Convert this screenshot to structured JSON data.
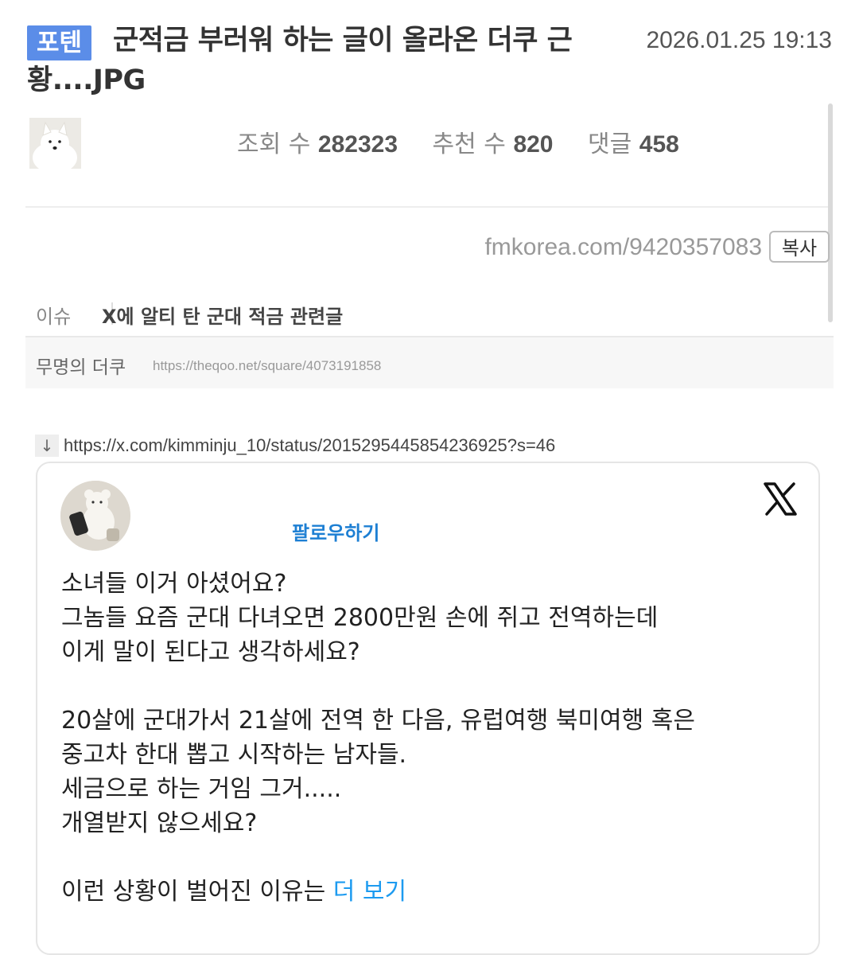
{
  "post": {
    "category": "포텐",
    "title": "군적금 부러워 하는 글이 올라온 더쿠 근황....JPG",
    "date": "2026.01.25 19:13"
  },
  "stats": {
    "views_label": "조회 수",
    "views": "282323",
    "recommend_label": "추천 수",
    "recommend": "820",
    "comments_label": "댓글",
    "comments": "458"
  },
  "share": {
    "short_url": "fmkorea.com/9420357083",
    "copy_label": "복사"
  },
  "issue": {
    "tag": "이슈",
    "title": "X에 알티 탄 군대 적금 관련글",
    "author": "무명의 더쿠",
    "source_url": "https://theqoo.net/square/4073191858"
  },
  "embed": {
    "icon": "download-arrow-icon",
    "url": "https://x.com/kimminju_10/status/2015295445854236925?s=46"
  },
  "tweet": {
    "follow_label": "팔로우하기",
    "lines": [
      "소녀들 이거 아셨어요?",
      "그놈들 요즘 군대 다녀오면 2800만원 손에 쥐고 전역하는데",
      "이게 말이 된다고 생각하세요?",
      "",
      "20살에 군대가서 21살에 전역 한 다음, 유럽여행 북미여행 혹은",
      "중고차 한대 뽑고 시작하는 남자들.",
      "세금으로 하는 거임 그거.....",
      "개열받지 않으세요?",
      ""
    ],
    "last_line": "이런 상황이 벌어진 이유는",
    "more_label": "더 보기"
  },
  "colors": {
    "badge": "#5b8de8",
    "follow": "#1d7fd3",
    "more": "#1d9bf0"
  }
}
